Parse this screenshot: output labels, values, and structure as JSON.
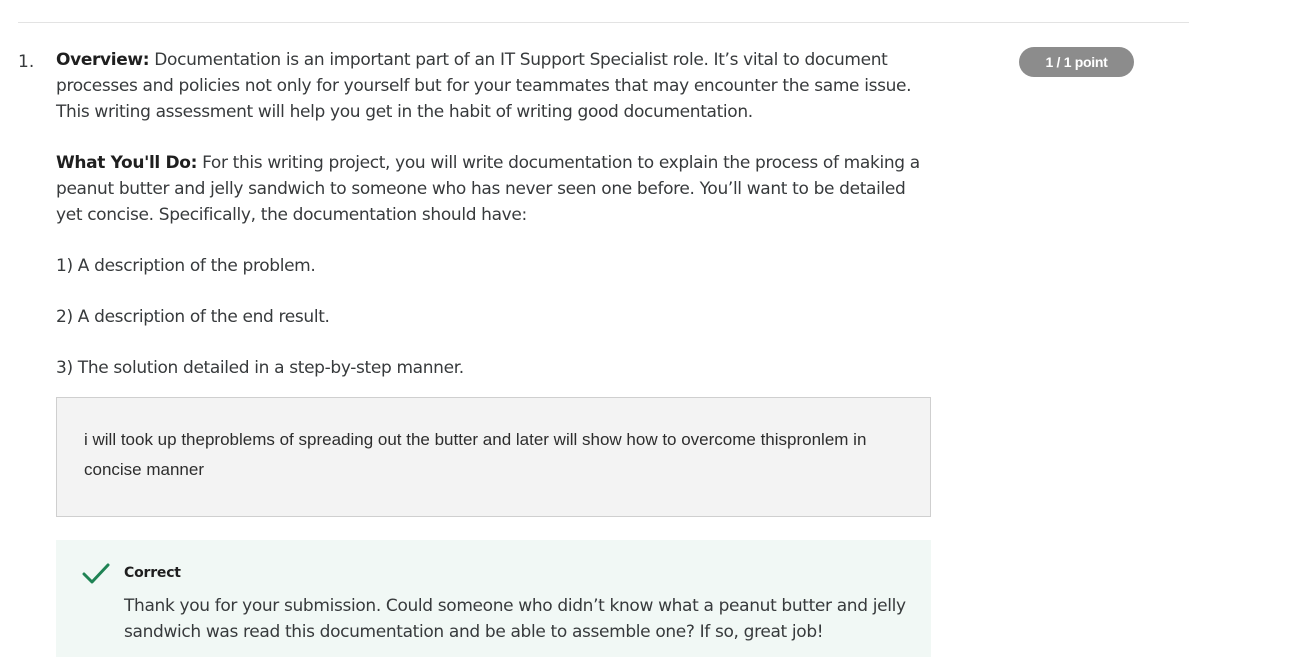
{
  "question": {
    "number": "1.",
    "points": "1 / 1 point",
    "overview_label": "Overview:",
    "overview_text": " Documentation is an important part of an IT Support Specialist role. It’s vital to document processes and policies not only for yourself but for your teammates that may encounter the same issue. This writing assessment will help you get in the habit of writing good documentation.",
    "todo_label": "What You'll Do:",
    "todo_text": " For this writing project, you will write documentation to explain the process of making a peanut butter and jelly sandwich to someone who has never seen one before. You’ll want to be detailed yet concise. Specifically, the documentation should have:",
    "requirements": [
      "1) A description of the problem.",
      "2) A description of the end result.",
      "3) The solution detailed in a step-by-step manner."
    ]
  },
  "answer": {
    "text": "i will took up theproblems of spreading out the butter and later will show how to overcome thispronlem in concise manner"
  },
  "feedback": {
    "status": "Correct",
    "icon": "checkmark-icon",
    "text": "Thank you for your submission. Could someone who didn’t know what a peanut butter and jelly sandwich was read this documentation and be able to assemble one? If so, great job!",
    "color": "#1f8354"
  }
}
